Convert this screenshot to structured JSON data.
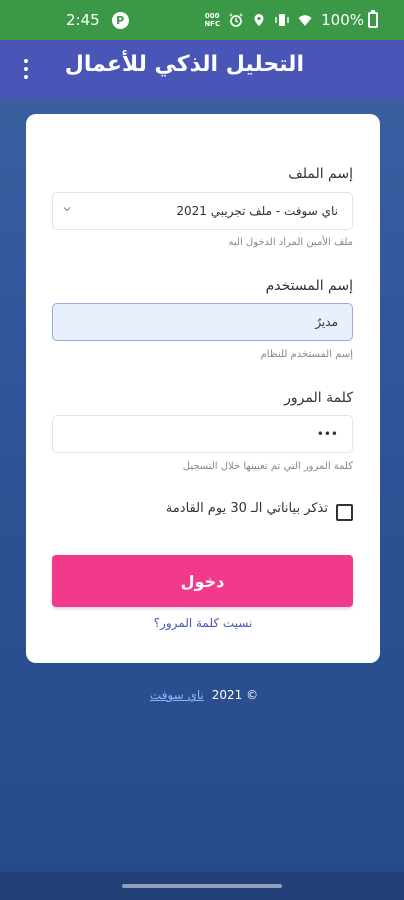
{
  "status_bar": {
    "time": "2:45",
    "app_badge": "P",
    "nfc_top": "000",
    "nfc_bottom": "NFC",
    "battery": "100%",
    "icons": [
      "alarm-icon",
      "location-icon",
      "vibrate-icon",
      "wifi-icon",
      "battery-icon"
    ]
  },
  "app_bar": {
    "title": "التحليل الذكي للأعمال",
    "menu_icon": "more-vert-icon"
  },
  "form": {
    "file_label": "إسم الملف",
    "file_value": "ناي سوفت - ملف تجريبي 2021",
    "file_hint": "ملف الأمين المراد الدخول اليه",
    "username_label": "إسم المستخدم",
    "username_value": "مديرٌ",
    "username_hint": "إسم المستخدم للنظام",
    "password_label": "كلمة المرور",
    "password_value": "•••",
    "password_hint": "كلمة المرور التي تم تعيينها خلال التسجيل",
    "remember_label": "تذكر بياناتي الـ 30 يوم القادمة",
    "remember_checked": false,
    "login_button": "دخول",
    "forgot_link": "نسيت كلمة المرور؟"
  },
  "footer": {
    "copyright": "© 2021",
    "company_link": "ناي سوفت"
  },
  "colors": {
    "status_bar": "#3a9846",
    "app_bar": "#4a55b8",
    "primary_button": "#f23a8c",
    "background": "#2f5497"
  }
}
